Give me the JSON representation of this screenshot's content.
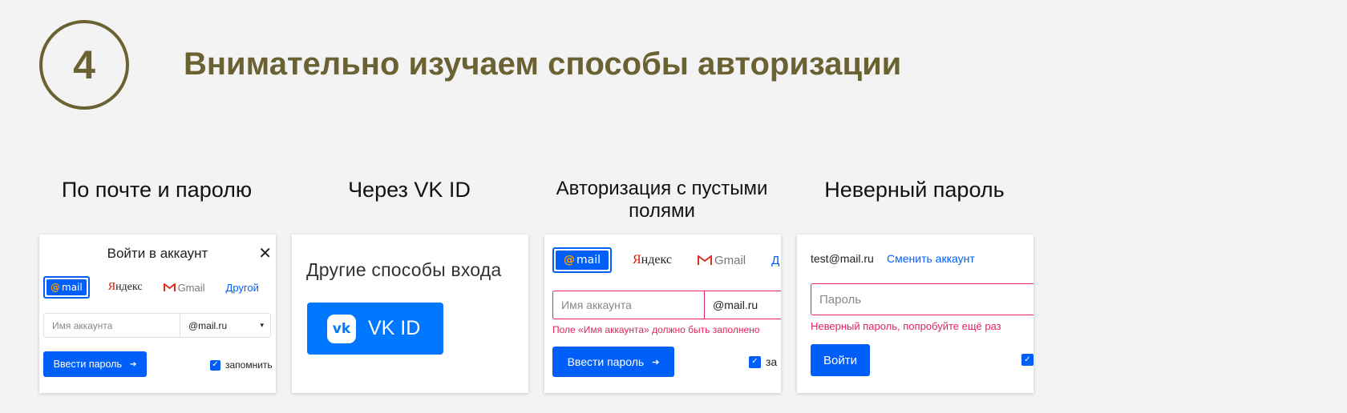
{
  "header": {
    "step_number": "4",
    "title": "Внимательно изучаем способы авторизации"
  },
  "captions": {
    "email_password": "По почте и паролю",
    "vk_id": "Через VK ID",
    "empty_fields": "Авторизация с пустыми полями",
    "wrong_password": "Неверный пароль"
  },
  "card_login": {
    "title": "Войти в аккаунт",
    "close": "✕",
    "providers": {
      "mail": "mail",
      "yandex_first": "Я",
      "yandex_rest": "ндекс",
      "gmail": "Gmail",
      "other": "Другой"
    },
    "account_placeholder": "Имя аккаунта",
    "domain": "@mail.ru",
    "domain_arrow": "▾",
    "submit": "Ввести пароль",
    "arrow": "➔",
    "remember": "запомнить"
  },
  "card_vk": {
    "title": "Другие способы входа",
    "vk_logo": "vk",
    "button": "VK ID"
  },
  "card_empty": {
    "providers": {
      "mail": "mail",
      "yandex_first": "Я",
      "yandex_rest": "ндекс",
      "gmail": "Gmail",
      "other": "Д"
    },
    "account_placeholder": "Имя аккаунта",
    "domain": "@mail.ru",
    "error": "Поле «Имя аккаунта» должно быть заполнено",
    "submit": "Ввести пароль",
    "arrow": "➔",
    "remember": "за"
  },
  "card_wrong": {
    "email": "test@mail.ru",
    "change": "Сменить аккаунт",
    "password_placeholder": "Пароль",
    "error": "Неверный пароль, попробуйте ещё раз",
    "submit": "Войти"
  },
  "colors": {
    "accent": "#005ff9",
    "title": "#6b6234",
    "error": "#e3245b",
    "vk": "#0077ff"
  }
}
